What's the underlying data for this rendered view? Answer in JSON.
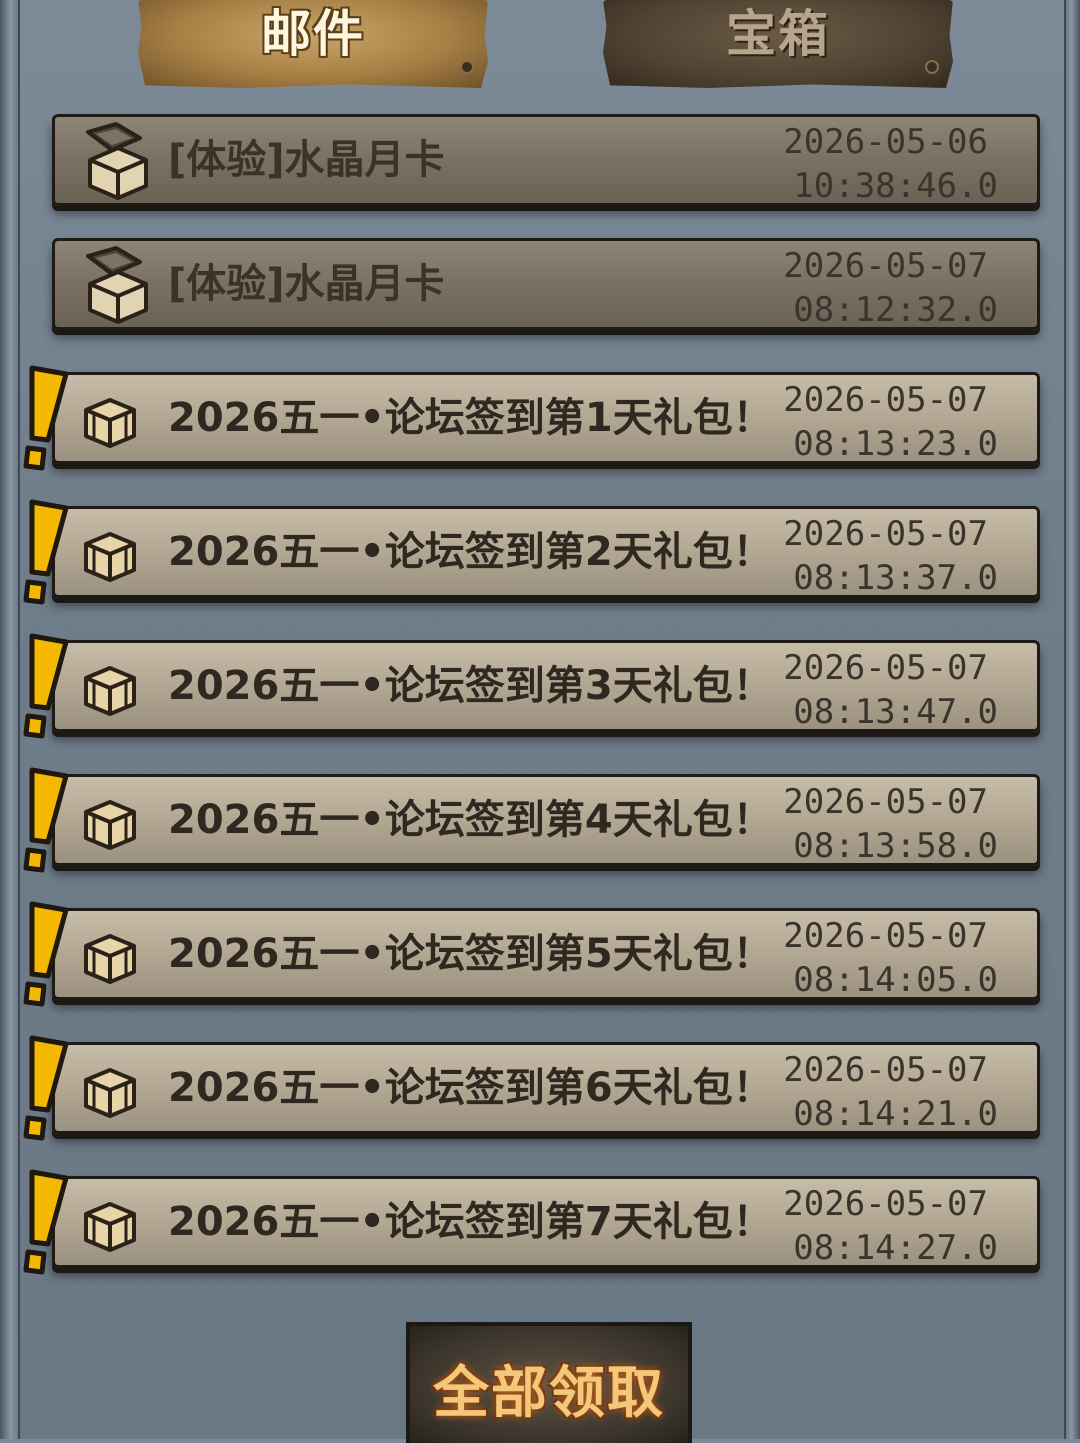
{
  "tabs": {
    "mail_label": "邮件",
    "chest_label": "宝箱"
  },
  "mails": [
    {
      "title": "[体验]水晶月卡",
      "date": "2026-05-06",
      "time": "10:38:46.0",
      "state": "read"
    },
    {
      "title": "[体验]水晶月卡",
      "date": "2026-05-07",
      "time": "08:12:32.0",
      "state": "read"
    },
    {
      "title": "2026五一•论坛签到第1天礼包！",
      "date": "2026-05-07",
      "time": "08:13:23.0",
      "state": "unread"
    },
    {
      "title": "2026五一•论坛签到第2天礼包！",
      "date": "2026-05-07",
      "time": "08:13:37.0",
      "state": "unread"
    },
    {
      "title": "2026五一•论坛签到第3天礼包！",
      "date": "2026-05-07",
      "time": "08:13:47.0",
      "state": "unread"
    },
    {
      "title": "2026五一•论坛签到第4天礼包！",
      "date": "2026-05-07",
      "time": "08:13:58.0",
      "state": "unread"
    },
    {
      "title": "2026五一•论坛签到第5天礼包！",
      "date": "2026-05-07",
      "time": "08:14:05.0",
      "state": "unread"
    },
    {
      "title": "2026五一•论坛签到第6天礼包！",
      "date": "2026-05-07",
      "time": "08:14:21.0",
      "state": "unread"
    },
    {
      "title": "2026五一•论坛签到第7天礼包！",
      "date": "2026-05-07",
      "time": "08:14:27.0",
      "state": "unread"
    }
  ],
  "actions": {
    "claim_all_label": "全部领取"
  },
  "icons": {
    "mail_item": "treasure-chest-icon",
    "unread_marker": "exclamation-icon"
  },
  "colors": {
    "unread_marker": "#f5b800",
    "claim_text": "#f4c87a"
  }
}
